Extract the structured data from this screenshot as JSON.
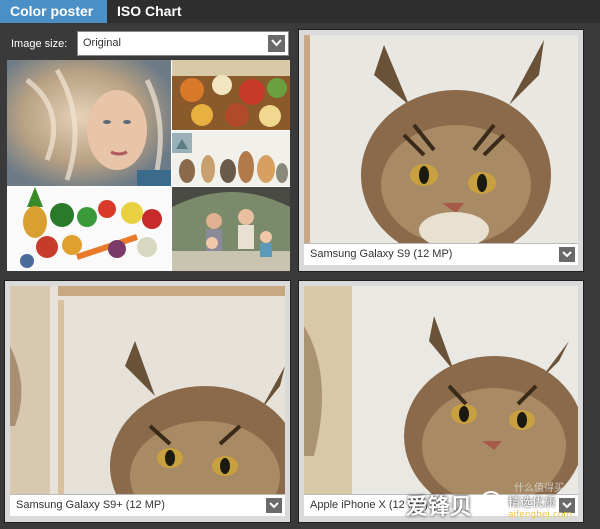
{
  "tabs": [
    {
      "label": "Color poster",
      "active": true
    },
    {
      "label": "ISO Chart",
      "active": false
    }
  ],
  "controls": {
    "image_size_label": "Image size:",
    "image_size_value": "Original"
  },
  "thumbnails": [
    {
      "name": "woman-portrait"
    },
    {
      "name": "food-table"
    },
    {
      "name": "pets-group"
    },
    {
      "name": "vegetables"
    },
    {
      "name": "family"
    }
  ],
  "panels": [
    {
      "caption": "Samsung Galaxy S9 (12 MP)"
    },
    {
      "caption": "Samsung Galaxy S9+ (12 MP)"
    },
    {
      "caption": "Apple iPhone X (12 MP)"
    }
  ],
  "watermark": {
    "brand": "爱锋贝",
    "slogan": "精选优质",
    "url": "aifengbei.com",
    "extra": "什么值得买"
  },
  "colors": {
    "accent": "#4a90c6",
    "background": "#3a3a3a"
  }
}
